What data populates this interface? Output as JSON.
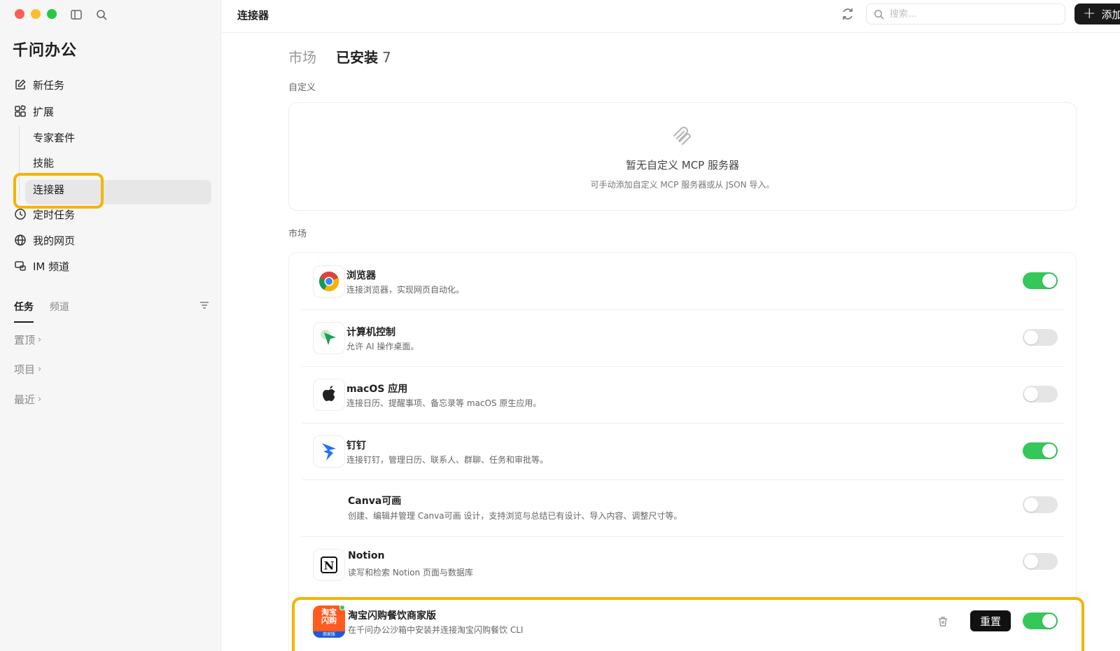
{
  "sidebar": {
    "brand": "千问办公",
    "nav": {
      "new_task": "新任务",
      "extensions": "扩展",
      "expert_suite": "专家套件",
      "skills": "技能",
      "connectors": "连接器",
      "scheduled": "定时任务",
      "my_pages": "我的网页",
      "im_channels": "IM 频道"
    },
    "tabs": {
      "tasks": "任务",
      "channels": "频道"
    },
    "groups": {
      "pinned": "置顶",
      "projects": "项目",
      "recent": "最近"
    }
  },
  "topbar": {
    "title": "连接器",
    "search_placeholder": "搜索...",
    "add_label": "添加"
  },
  "main": {
    "tabs": {
      "market": "市场",
      "installed": "已安装",
      "installed_count": "7"
    },
    "custom_section": "自定义",
    "empty": {
      "title": "暂无自定义 MCP 服务器",
      "desc": "可手动添加自定义 MCP 服务器或从 JSON 导入。"
    },
    "market_section": "市场",
    "connectors": [
      {
        "name": "浏览器",
        "desc": "连接浏览器，实现网页自动化。",
        "icon": "chrome-icon",
        "enabled": true
      },
      {
        "name": "计算机控制",
        "desc": "允许 AI 操作桌面。",
        "icon": "cursor-icon",
        "enabled": false
      },
      {
        "name": "macOS 应用",
        "desc": "连接日历、提醒事项、备忘录等 macOS 原生应用。",
        "icon": "apple-icon",
        "enabled": false
      },
      {
        "name": "钉钉",
        "desc": "连接钉钉，管理日历、联系人、群聊、任务和审批等。",
        "icon": "dingtalk-icon",
        "enabled": true
      },
      {
        "name": "Canva可画",
        "desc": "创建、编辑并管理 Canva可画 设计，支持浏览与总结已有设计、导入内容、调整尺寸等。",
        "icon": "",
        "enabled": false
      },
      {
        "name": "Notion",
        "desc": "读写和检索 Notion 页面与数据库",
        "icon": "notion-icon",
        "enabled": false
      },
      {
        "name": "淘宝闪购餐饮商家版",
        "desc": "在千问办公沙箱中安装并连接淘宝闪购餐饮 CLI",
        "icon": "taobao-shangou-icon",
        "icon_text": "淘宝闪购",
        "icon_subtext": "商家版",
        "enabled": true,
        "reset_label": "重置"
      }
    ]
  },
  "colors": {
    "highlight": "#f5b400",
    "toggle_on": "#34c759",
    "accent_dark": "#1a1a1a"
  }
}
